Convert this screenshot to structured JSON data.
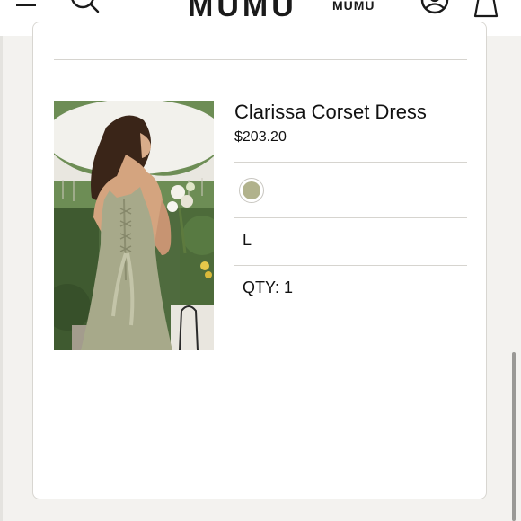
{
  "header": {
    "brand": "MUMU",
    "brand_secondary": "MUMU"
  },
  "product": {
    "name": "Clarissa Corset Dress",
    "price": "$203.20",
    "color_swatch": "#b1b28c",
    "size": "L",
    "qty_label": "QTY:",
    "qty_value": "1"
  },
  "icons": {
    "menu": "hamburger-icon",
    "search": "search-icon",
    "account": "account-icon",
    "bag": "bag-icon"
  }
}
